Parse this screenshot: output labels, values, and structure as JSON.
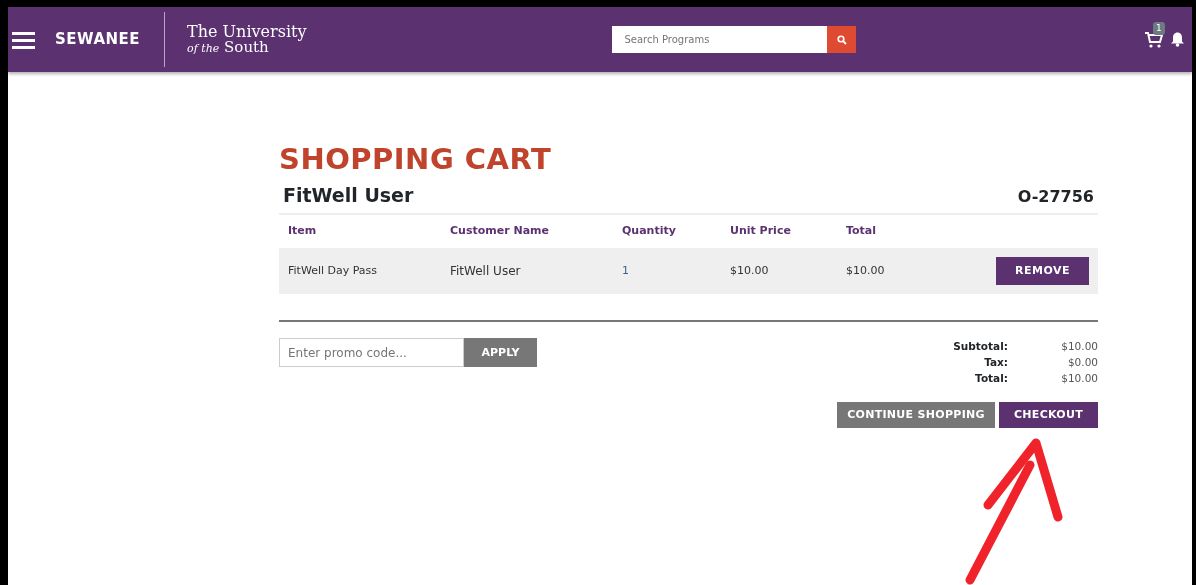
{
  "header": {
    "brand": "SEWANEE",
    "logo_line1": "The University",
    "logo_line2_italic": "of the",
    "logo_line2": "South",
    "search": {
      "placeholder": "Search Programs"
    },
    "cart_count": "1"
  },
  "cart": {
    "title": "SHOPPING CART",
    "customer": "FitWell User",
    "order_number": "O-27756",
    "columns": [
      "Item",
      "Customer Name",
      "Quantity",
      "Unit Price",
      "Total"
    ],
    "rows": [
      {
        "cells": [
          "FitWell Day Pass",
          "FitWell User",
          "1",
          "$10.00",
          "$10.00"
        ],
        "action": "REMOVE"
      }
    ],
    "promo": {
      "placeholder": "Enter promo code...",
      "button": "APPLY"
    },
    "summary": [
      {
        "label": "Subtotal:",
        "value": "$10.00"
      },
      {
        "label": "Tax:",
        "value": "$0.00"
      },
      {
        "label": "Total:",
        "value": "$10.00"
      }
    ],
    "buttons": [
      {
        "label": "CONTINUE SHOPPING",
        "kind": "secondary"
      },
      {
        "label": "CHECKOUT",
        "kind": "primary"
      }
    ]
  },
  "annotation": {
    "kind": "arrow"
  }
}
